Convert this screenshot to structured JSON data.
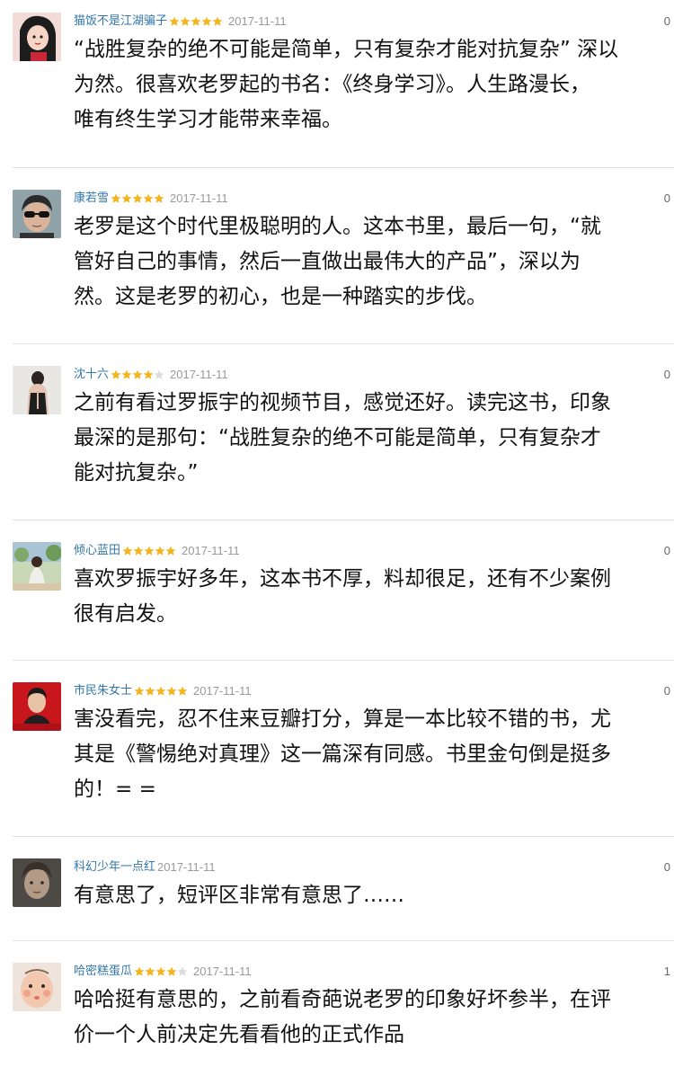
{
  "reviews": [
    {
      "username": "猫饭不是江湖骗子",
      "rating": 5,
      "date": "2017-11-11",
      "votes": "0",
      "avatar": "avatar-anime-girl",
      "lines": [
        "“战胜复杂的绝不可能是简单，只有复杂才能对抗复杂” 深以",
        "为然。很喜欢老罗起的书名：《终身学习》。人生路漫长，",
        "唯有终生学习才能带来幸福。"
      ]
    },
    {
      "username": "康若雪",
      "rating": 5,
      "date": "2017-11-11",
      "votes": "0",
      "avatar": "avatar-man-sunglasses",
      "lines": [
        "老罗是这个时代里极聪明的人。这本书里，最后一句，“就",
        "管好自己的事情，然后一直做出最伟大的产品”，深以为",
        "然。这是老罗的初心，也是一种踏实的步伐。"
      ]
    },
    {
      "username": "沈十六",
      "rating": 4,
      "date": "2017-11-11",
      "votes": "0",
      "avatar": "avatar-woman-back",
      "lines": [
        "之前有看过罗振宇的视频节目，感觉还好。读完这书，印象",
        "最深的是那句：“战胜复杂的绝不可能是简单，只有复杂才",
        "能对抗复杂。”"
      ]
    },
    {
      "username": "倾心蓝田",
      "rating": 5,
      "date": "2017-11-11",
      "votes": "0",
      "avatar": "avatar-garden-girl",
      "lines": [
        "喜欢罗振宇好多年，这本书不厚，料却很足，还有不少案例",
        "很有启发。"
      ]
    },
    {
      "username": "市民朱女士",
      "rating": 5,
      "date": "2017-11-11",
      "votes": "0",
      "avatar": "avatar-red-portrait",
      "lines": [
        "害没看完，忍不住来豆瓣打分，算是一本比较不错的书，尤",
        "其是《警惕绝对真理》这一篇深有同感。书里金句倒是挺多",
        "的！= ="
      ]
    },
    {
      "username": "科幻少年一点红",
      "rating": 0,
      "date": "2017-11-11",
      "votes": "0",
      "avatar": "avatar-gray-face",
      "lines": [
        "有意思了，短评区非常有意思了……"
      ]
    },
    {
      "username": "哈密糕蛋瓜",
      "rating": 4,
      "date": "2017-11-11",
      "votes": "1",
      "avatar": "avatar-baby",
      "lines": [
        "哈哈挺有意思的，之前看奇葩说老罗的印象好坏参半，在评",
        "价一个人前决定先看看他的正式作品"
      ]
    }
  ],
  "colors": {
    "username": "#3377aa",
    "star_on": "#f4b41b",
    "star_off": "#dddddd",
    "date": "#999999",
    "divider": "#e0e0e0"
  }
}
